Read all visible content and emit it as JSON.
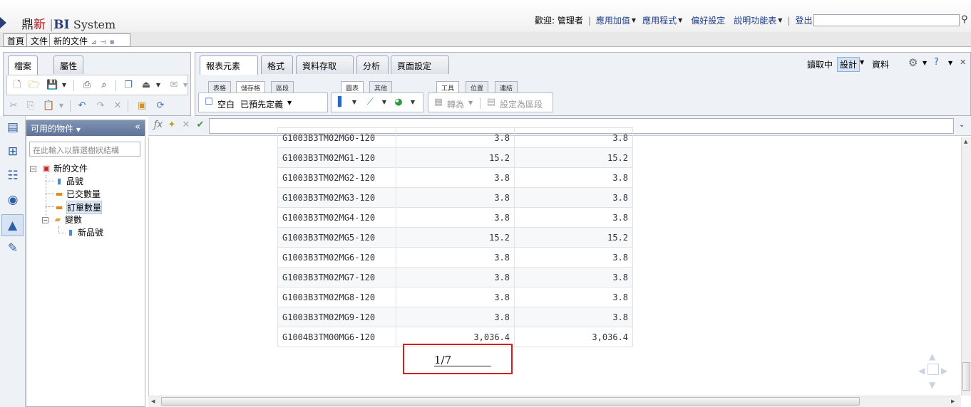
{
  "header": {
    "logo_brand": "鼎",
    "logo_accent": "新",
    "logo_bi": "BI",
    "logo_system": "System",
    "welcome": "歡迎: 管理者",
    "menu": [
      {
        "label": "應用加值"
      },
      {
        "label": "應用程式"
      },
      {
        "label": "偏好設定"
      },
      {
        "label": "說明功能表"
      }
    ],
    "logout": "登出",
    "search_value": ""
  },
  "doc_tabs": {
    "home": "首頁",
    "docs": "文件",
    "current": "新的文件"
  },
  "left_pane_tabs": [
    "檔案",
    "屬性"
  ],
  "right_pane": {
    "tabs": [
      "報表元素",
      "格式",
      "資料存取",
      "分析",
      "頁面設定"
    ],
    "modes": {
      "reading": "讀取中",
      "design": "設計",
      "data": "資料"
    },
    "group1": {
      "tabs": [
        "表格",
        "儲存格",
        "區段"
      ],
      "blank": "空白",
      "predefined": "已預先定義"
    },
    "group2": {
      "tabs": [
        "圖表",
        "其他"
      ]
    },
    "group3": {
      "tabs": [
        "工具",
        "位置",
        "連結"
      ],
      "convert": "轉為",
      "set_section": "設定為區段"
    }
  },
  "objects_panel": {
    "title": "可用的物件",
    "filter_placeholder": "在此輸入以篩選樹狀結構",
    "tree": {
      "root": "新的文件",
      "items": [
        "品號",
        "已交數量",
        "訂單數量"
      ],
      "variables": "變數",
      "var_items": [
        "新品號"
      ]
    }
  },
  "report": {
    "rows": [
      {
        "code": "G1003B3TM02MG0-120",
        "v1": "3.8",
        "v2": "3.8"
      },
      {
        "code": "G1003B3TM02MG1-120",
        "v1": "15.2",
        "v2": "15.2"
      },
      {
        "code": "G1003B3TM02MG2-120",
        "v1": "3.8",
        "v2": "3.8"
      },
      {
        "code": "G1003B3TM02MG3-120",
        "v1": "3.8",
        "v2": "3.8"
      },
      {
        "code": "G1003B3TM02MG4-120",
        "v1": "3.8",
        "v2": "3.8"
      },
      {
        "code": "G1003B3TM02MG5-120",
        "v1": "15.2",
        "v2": "15.2"
      },
      {
        "code": "G1003B3TM02MG6-120",
        "v1": "3.8",
        "v2": "3.8"
      },
      {
        "code": "G1003B3TM02MG7-120",
        "v1": "3.8",
        "v2": "3.8"
      },
      {
        "code": "G1003B3TM02MG8-120",
        "v1": "3.8",
        "v2": "3.8"
      },
      {
        "code": "G1003B3TM02MG9-120",
        "v1": "3.8",
        "v2": "3.8"
      },
      {
        "code": "G1004B3TM00MG6-120",
        "v1": "3,036.4",
        "v2": "3,036.4"
      }
    ],
    "page_indicator": "1/7"
  },
  "colors": {
    "highlight_border": "#d31f1f",
    "brand_blue": "#2a3f7a",
    "brand_red": "#b0171c"
  },
  "icons": {
    "tree_root": "document-icon",
    "item_dimension": "dimension-icon",
    "item_measure": "measure-icon",
    "folder": "folder-icon",
    "search": "search-icon"
  }
}
